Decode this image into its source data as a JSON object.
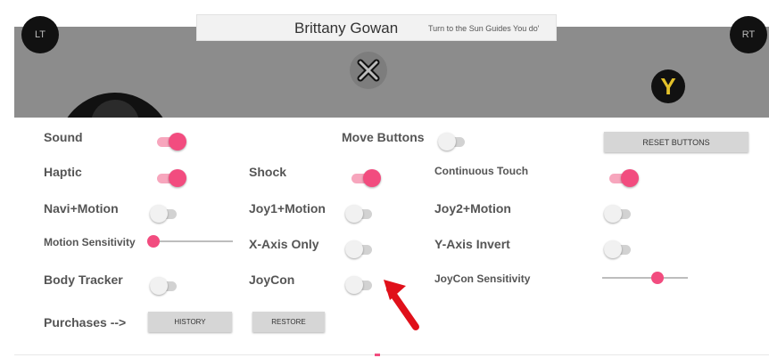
{
  "header": {
    "title": "Brittany Gowan",
    "subtitle": "Turn to the Sun Guides You do'"
  },
  "controller": {
    "left_trigger_label": "LT",
    "right_trigger_label": "RT",
    "y_button_label": "Y",
    "x_button_icon": "x-button-icon",
    "y_button_color": "#e3c12a"
  },
  "settings": {
    "sound_label": "Sound",
    "sound_on": true,
    "move_buttons_label": "Move Buttons",
    "move_buttons_on": false,
    "reset_buttons_label": "RESET BUTTONS",
    "haptic_label": "Haptic",
    "haptic_on": true,
    "shock_label": "Shock",
    "shock_on": true,
    "continuous_touch_label": "Continuous Touch",
    "continuous_touch_on": true,
    "navi_motion_label": "Navi+Motion",
    "navi_motion_on": false,
    "joy1_motion_label": "Joy1+Motion",
    "joy1_motion_on": false,
    "joy2_motion_label": "Joy2+Motion",
    "joy2_motion_on": false,
    "motion_sensitivity_label": "Motion Sensitivity",
    "motion_sensitivity_value": 0.0,
    "x_axis_only_label": "X-Axis Only",
    "x_axis_only_on": false,
    "y_axis_invert_label": "Y-Axis Invert",
    "y_axis_invert_on": false,
    "body_tracker_label": "Body Tracker",
    "body_tracker_on": false,
    "joycon_label": "JoyCon",
    "joycon_on": false,
    "joycon_sensitivity_label": "JoyCon Sensitivity",
    "joycon_sensitivity_value": 0.67,
    "purchases_label": "Purchases -->",
    "history_label": "HISTORY",
    "restore_label": "RESTORE"
  },
  "colors": {
    "accent": "#f24c7f",
    "overlay": "#8c8c8c",
    "annotation_arrow": "#e0101a"
  }
}
